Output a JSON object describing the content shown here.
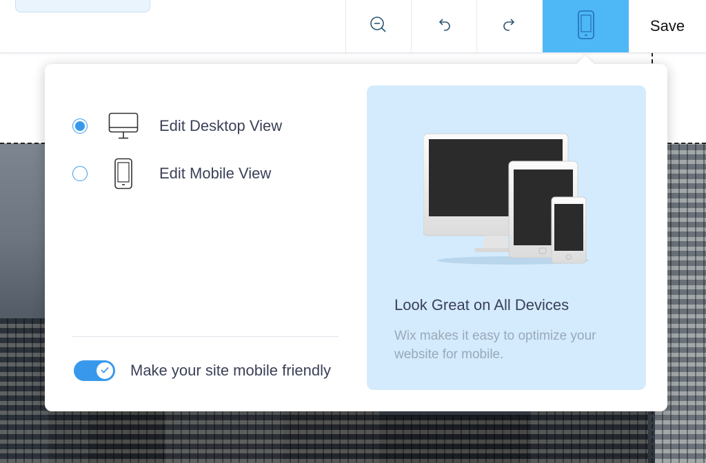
{
  "toolbar": {
    "zoom_out_icon": "zoom-out-icon",
    "undo_icon": "undo-icon",
    "redo_icon": "redo-icon",
    "mobile_view_icon": "mobile-icon",
    "save_label": "Save",
    "accent_color": "#4eb7f5"
  },
  "top_pill": {
    "close_glyph": "×"
  },
  "popover": {
    "options": [
      {
        "label": "Edit Desktop View",
        "icon": "desktop-icon",
        "selected": true
      },
      {
        "label": "Edit Mobile View",
        "icon": "mobile-icon",
        "selected": false
      }
    ],
    "toggle": {
      "label": "Make your site mobile friendly",
      "on": true
    },
    "promo": {
      "title": "Look Great on All Devices",
      "text": "Wix makes it easy to optimize your website for mobile.",
      "background": "#d3ebfd"
    }
  }
}
